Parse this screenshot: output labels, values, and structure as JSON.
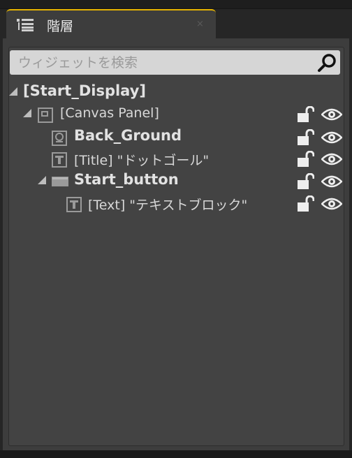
{
  "tab": {
    "title": "階層",
    "close_glyph": "×"
  },
  "search": {
    "placeholder": "ウィジェットを検索",
    "value": ""
  },
  "tree": [
    {
      "label": "[Start_Display]",
      "bold": true,
      "expanded": true,
      "icon": "none"
    },
    {
      "label": "[Canvas Panel]",
      "bold": false,
      "expanded": true,
      "icon": "canvas-panel-icon"
    },
    {
      "label": "Back_Ground",
      "bold": true,
      "icon": "image-widget-icon"
    },
    {
      "label": "[Title] \"ドットゴール\"",
      "bold": false,
      "icon": "text-widget-icon"
    },
    {
      "label": "Start_button",
      "bold": true,
      "expanded": true,
      "icon": "button-widget-icon"
    },
    {
      "label": "[Text] \"テキストブロック\"",
      "bold": false,
      "icon": "text-widget-icon"
    }
  ],
  "colors": {
    "tab_accent": "#e6b400",
    "panel": "#3d3d3d",
    "tree_bg": "#434343"
  }
}
